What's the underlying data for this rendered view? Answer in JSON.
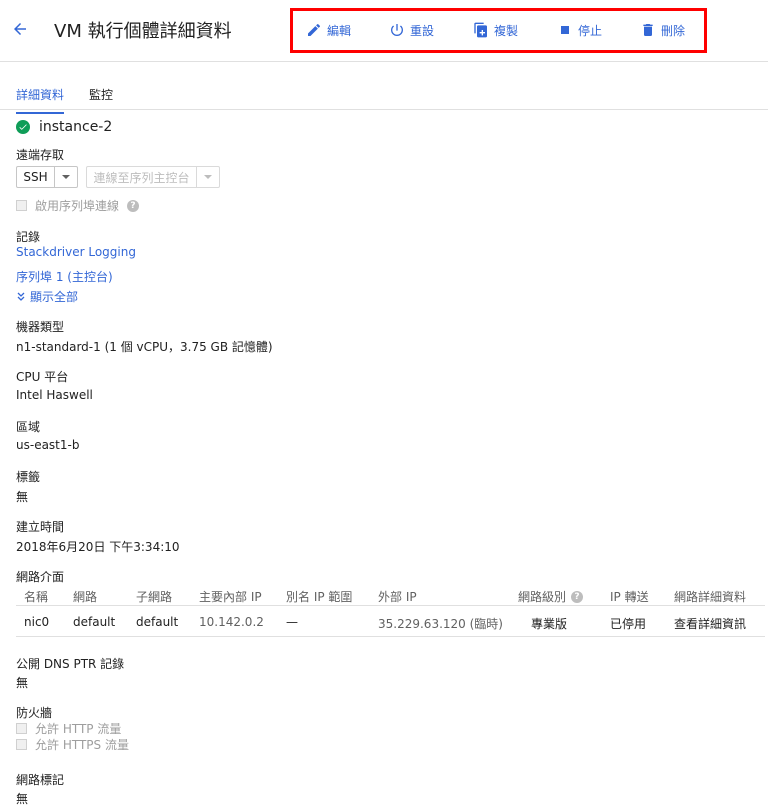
{
  "header": {
    "title": "VM 執行個體詳細資料",
    "actions": {
      "edit": "編輯",
      "reset": "重設",
      "clone": "複製",
      "stop": "停止",
      "delete": "刪除"
    }
  },
  "tabs": {
    "details": "詳細資料",
    "monitoring": "監控"
  },
  "instance": {
    "name": "instance-2",
    "status_color": "#0f9d58"
  },
  "remote_access": {
    "label": "遠端存取",
    "ssh": "SSH",
    "serial_console": "連線至序列主控台",
    "serial_port_checkbox": "啟用序列埠連線"
  },
  "logging": {
    "label": "記錄",
    "stackdriver": "Stackdriver Logging",
    "serial_port": "序列埠 1 (主控台)",
    "show_all": "顯示全部"
  },
  "machine_type": {
    "label": "機器類型",
    "value": "n1-standard-1 (1 個 vCPU，3.75 GB 記憶體)"
  },
  "cpu_platform": {
    "label": "CPU 平台",
    "value": "Intel Haswell"
  },
  "zone": {
    "label": "區域",
    "value": "us-east1-b"
  },
  "labels": {
    "label": "標籤",
    "value": "無"
  },
  "created": {
    "label": "建立時間",
    "value": "2018年6月20日 下午3:34:10"
  },
  "network_interfaces": {
    "label": "網路介面",
    "columns": [
      "名稱",
      "網路",
      "子網路",
      "主要內部 IP",
      "別名 IP 範圍",
      "外部 IP",
      "網路級別",
      "IP 轉送",
      "網路詳細資料"
    ],
    "rows": [
      [
        "nic0",
        "default",
        "default",
        "10.142.0.2",
        "—",
        "35.229.63.120 (臨時)",
        "專業版",
        "已停用",
        "查看詳細資訊"
      ]
    ]
  },
  "public_dns": {
    "label": "公開 DNS PTR 記錄",
    "value": "無"
  },
  "firewall": {
    "label": "防火牆",
    "http": "允許 HTTP 流量",
    "https": "允許 HTTPS 流量"
  },
  "network_tags": {
    "label": "網路標記",
    "value": "無"
  },
  "colors": {
    "accent": "#3367d6",
    "highlight_border": "#ff0000"
  }
}
